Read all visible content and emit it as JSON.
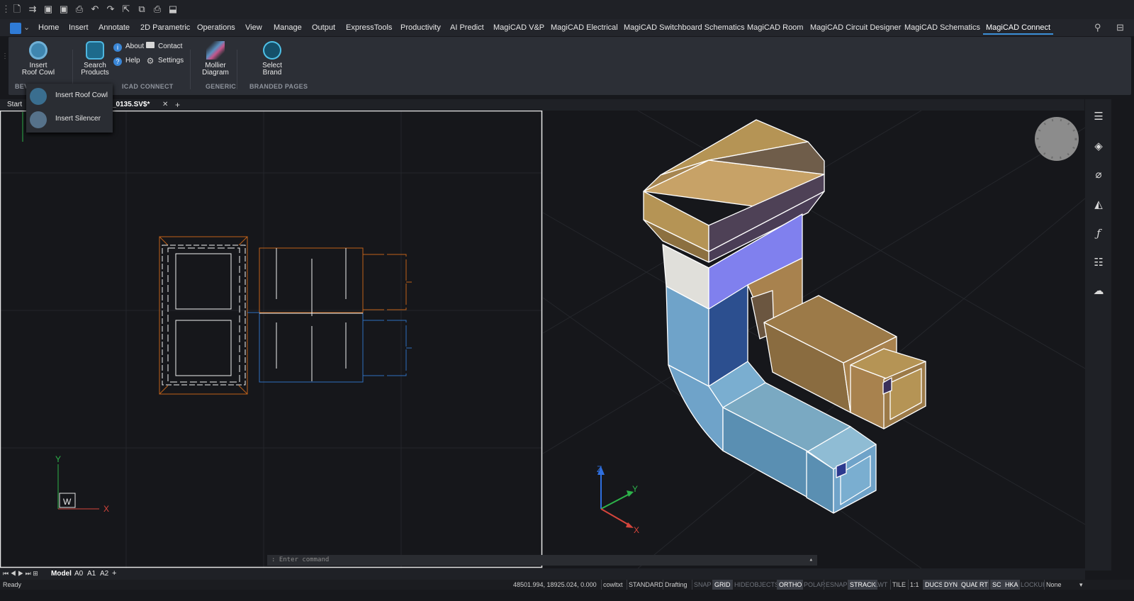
{
  "quick_access": {
    "icons": [
      "new-icon",
      "open-icon",
      "save-icon",
      "save-as-icon",
      "print-icon",
      "undo-icon",
      "redo-icon",
      "export-icon",
      "copy-icon",
      "plot-icon",
      "share-icon"
    ]
  },
  "ribbon": {
    "tabs": [
      "Home",
      "Insert",
      "Annotate",
      "2D Parametric",
      "Operations",
      "View",
      "Manage",
      "Output",
      "ExpressTools",
      "Productivity",
      "AI Predict",
      "MagiCAD V&P",
      "MagiCAD Electrical",
      "MagiCAD Switchboard Schematics",
      "MagiCAD Room",
      "MagiCAD Circuit Designer",
      "MagiCAD Schematics",
      "MagiCAD Connect"
    ],
    "active_tab": "MagiCAD Connect",
    "buttons": {
      "insert_roof_cowl": "Insert\nRoof Cowl",
      "search_products": "Search\nProducts",
      "about": "About",
      "contact": "Contact",
      "help": "Help",
      "settings": "Settings",
      "mollier_diagram": "Mollier\nDiagram",
      "select_brand": "Select\nBrand"
    },
    "groups": {
      "bev": "BEV",
      "magicad_connect": "ICAD CONNECT",
      "generic": "GENERIC",
      "branded_pages": "BRANDED PAGES"
    }
  },
  "dropdown": {
    "items": [
      "Insert Roof Cowl",
      "Insert Silencer"
    ]
  },
  "document_tabs": {
    "start": "Start",
    "current_file": "_0135.SV$*",
    "close": "✕",
    "add": "+"
  },
  "viewport_left": {
    "ucs_y": "Y",
    "ucs_x": "X",
    "ucs_w": "W"
  },
  "viewport_right": {
    "ucs_z": "Z",
    "ucs_y": "Y",
    "ucs_x": "X"
  },
  "command_line": {
    "placeholder": ": Enter command"
  },
  "layout_tabs": [
    "Model",
    "A0",
    "A1",
    "A2"
  ],
  "layout_add": "+",
  "status_bar": {
    "status": "Ready",
    "coordinates": "48501.994, 18925.024, 0.000",
    "items": [
      {
        "label": "cowltxt",
        "state": "plain"
      },
      {
        "label": "STANDARD",
        "state": "plain"
      },
      {
        "label": "Drafting",
        "state": "plain"
      },
      {
        "label": "SNAP",
        "state": "off"
      },
      {
        "label": "GRID",
        "state": "on"
      },
      {
        "label": "HIDEOBJECTS",
        "state": "off"
      },
      {
        "label": "ORTHO",
        "state": "on"
      },
      {
        "label": "POLAR",
        "state": "off"
      },
      {
        "label": "ESNAP",
        "state": "off"
      },
      {
        "label": "STRACK",
        "state": "on"
      },
      {
        "label": "LWT",
        "state": "off"
      },
      {
        "label": "TILE",
        "state": "plain"
      },
      {
        "label": "1:1",
        "state": "plain"
      },
      {
        "label": "DUCS",
        "state": "on"
      },
      {
        "label": "DYN",
        "state": "on"
      },
      {
        "label": "QUAD",
        "state": "on"
      },
      {
        "label": "RT",
        "state": "on"
      },
      {
        "label": "SC",
        "state": "on"
      },
      {
        "label": "HKA",
        "state": "on"
      },
      {
        "label": "LOCKUI",
        "state": "off"
      },
      {
        "label": "None",
        "state": "plain"
      }
    ]
  },
  "colors": {
    "accent": "#3b8fd8",
    "cowl_top": "#b59455",
    "duct_blue": "#6fa3c9",
    "duct_tan": "#a8824e",
    "orange_2d": "#c0621a",
    "blue_2d": "#2f6fbf"
  }
}
